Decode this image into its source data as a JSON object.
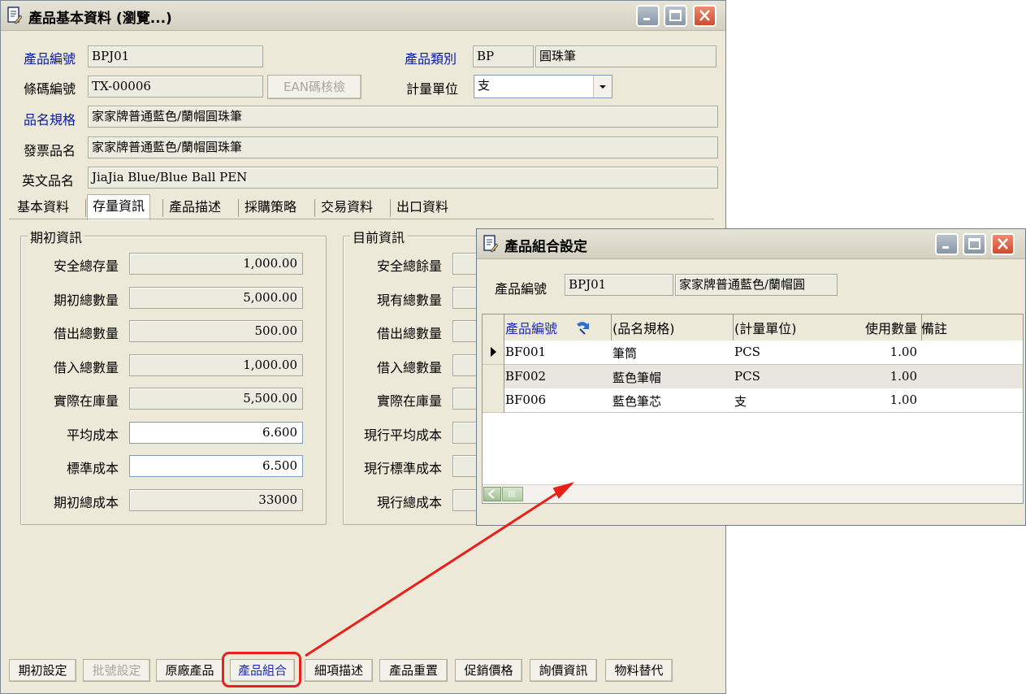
{
  "main_window": {
    "title": "產品基本資料 (瀏覽...)",
    "fields": {
      "product_no_label": "產品編號",
      "product_no": "BPJ01",
      "category_label": "產品類別",
      "category_code": "BP",
      "category_name": "圓珠筆",
      "barcode_label": "條碼編號",
      "barcode": "TX-00006",
      "ean_button": "EAN碼核檢",
      "unit_label": "計量單位",
      "unit": "支",
      "spec_label": "品名規格",
      "spec": "家家牌普通藍色/蘭帽圓珠筆",
      "invoice_label": "發票品名",
      "invoice_name": "家家牌普通藍色/蘭帽圓珠筆",
      "english_label": "英文品名",
      "english_name": "JiaJia Blue/Blue Ball PEN"
    },
    "tabs": [
      "基本資料",
      "存量資訊",
      "產品描述",
      "採購策略",
      "交易資料",
      "出口資料"
    ],
    "active_tab": "存量資訊",
    "initial_group": {
      "title": "期初資訊",
      "rows": [
        {
          "label": "安全總存量",
          "value": "1,000.00",
          "editable": false
        },
        {
          "label": "期初總數量",
          "value": "5,000.00",
          "editable": false
        },
        {
          "label": "借出總數量",
          "value": "500.00",
          "editable": false
        },
        {
          "label": "借入總數量",
          "value": "1,000.00",
          "editable": false
        },
        {
          "label": "實際在庫量",
          "value": "5,500.00",
          "editable": false
        },
        {
          "label": "平均成本",
          "value": "6.600",
          "editable": true
        },
        {
          "label": "標準成本",
          "value": "6.500",
          "editable": true
        },
        {
          "label": "期初總成本",
          "value": "33000",
          "editable": false
        }
      ]
    },
    "current_group": {
      "title": "目前資訊",
      "rows": [
        "安全總餘量",
        "現有總數量",
        "借出總數量",
        "借入總數量",
        "實際在庫量",
        "現行平均成本",
        "現行標準成本",
        "現行總成本"
      ]
    },
    "bottom_buttons": [
      {
        "label": "期初設定",
        "state": "normal"
      },
      {
        "label": "批號設定",
        "state": "disabled"
      },
      {
        "label": "原廠產品",
        "state": "normal"
      },
      {
        "label": "產品組合",
        "state": "selected"
      },
      {
        "label": "細項描述",
        "state": "normal"
      },
      {
        "label": "產品重置",
        "state": "normal"
      },
      {
        "label": "促銷價格",
        "state": "normal"
      },
      {
        "label": "詢價資訊",
        "state": "normal"
      },
      {
        "label": "物料替代",
        "state": "normal"
      }
    ]
  },
  "combo_window": {
    "title": "產品組合設定",
    "product_no_label": "產品編號",
    "product_no": "BPJ01",
    "product_name": "家家牌普通藍色/蘭帽圓",
    "columns": [
      "產品編號",
      "(品名規格)",
      "(計量單位)",
      "使用數量",
      "備註"
    ],
    "rows": [
      {
        "code": "BF001",
        "name": "筆筒",
        "unit": "PCS",
        "qty": "1.00",
        "note": ""
      },
      {
        "code": "BF002",
        "name": "藍色筆帽",
        "unit": "PCS",
        "qty": "1.00",
        "note": ""
      },
      {
        "code": "BF006",
        "name": "藍色筆芯",
        "unit": "支",
        "qty": "1.00",
        "note": ""
      }
    ]
  },
  "colors": {
    "window_bg": "#ece9d8",
    "label_blue": "#0a1aa0",
    "highlight_red": "#e8201c",
    "close_red": "#d9573a"
  }
}
